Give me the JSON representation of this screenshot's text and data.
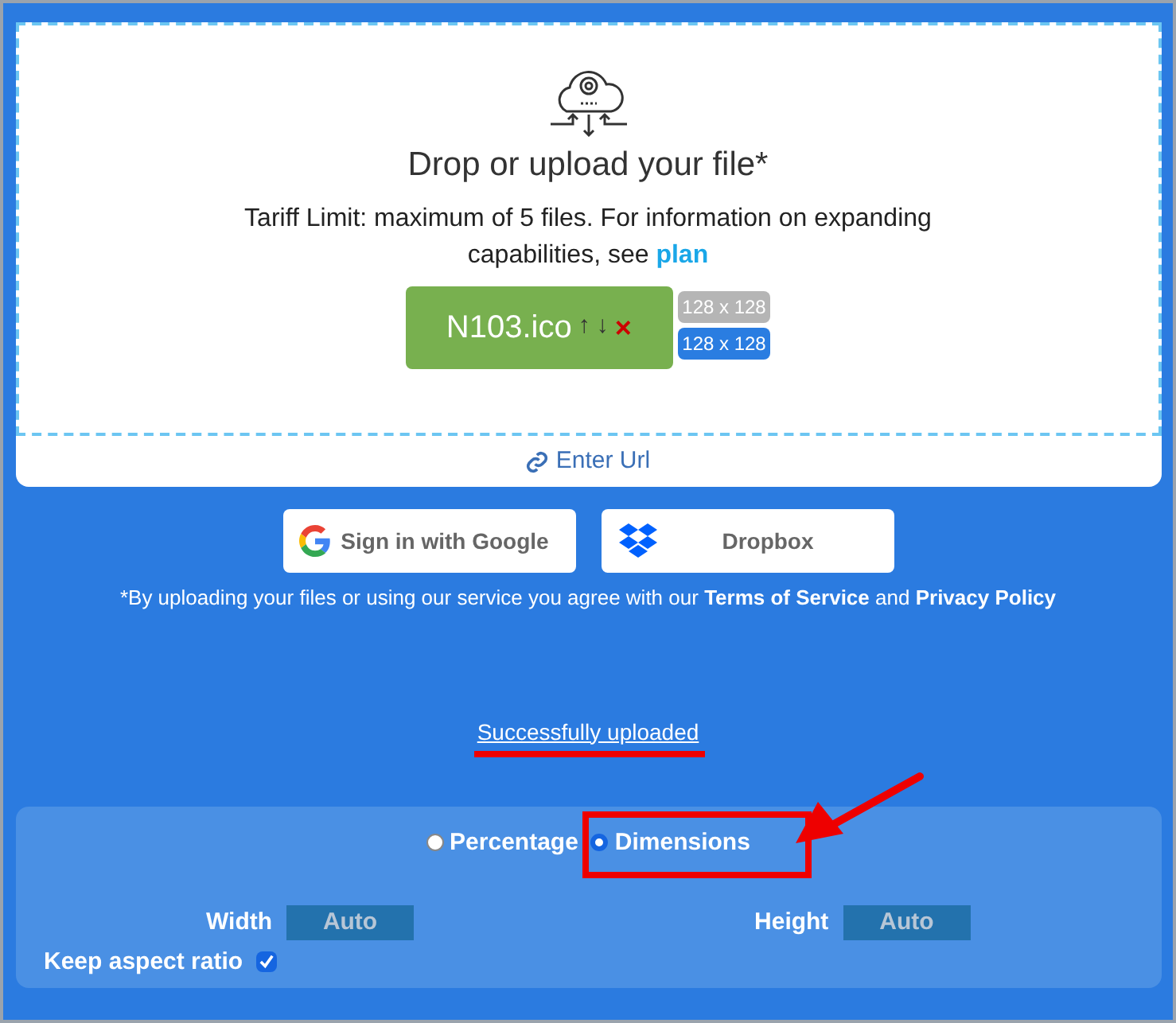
{
  "upload": {
    "title": "Drop or upload your file*",
    "limit_text": "Tariff Limit: maximum of 5 files. For information on expanding capabilities, see",
    "limit_link": "plan",
    "file": {
      "name": "N103.ico",
      "up": "↑",
      "down": "↓",
      "remove": "×",
      "sizes": [
        {
          "label": "128 x 128",
          "kind": "original"
        },
        {
          "label": "128 x 128",
          "kind": "target"
        }
      ]
    },
    "url_link": "Enter Url"
  },
  "sources": [
    {
      "label": "Sign in with Google",
      "kind": "google"
    },
    {
      "label": "Dropbox",
      "kind": "dropbox"
    }
  ],
  "terms": {
    "text": "*By uploading your files or using our service you agree with our",
    "terms_link": "Terms of Service",
    "and": "and",
    "privacy_link": "Privacy Policy"
  },
  "status": "Successfully uploaded",
  "options": {
    "modes": [
      {
        "label": "Percentage",
        "selected": false
      },
      {
        "label": "Dimensions",
        "selected": true
      }
    ],
    "width": {
      "label": "Width",
      "placeholder": "Auto"
    },
    "height": {
      "label": "Height",
      "placeholder": "Auto"
    },
    "keep_ratio": {
      "label": "Keep aspect ratio",
      "checked": true
    }
  }
}
